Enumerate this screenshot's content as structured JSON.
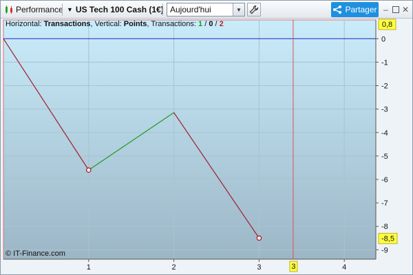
{
  "toolbar": {
    "app_title": "Performance",
    "instrument": "US Tech 100 Cash (1€)",
    "period_value": "Aujourd'hui",
    "share_label": "Partager",
    "icons": [
      "chart-candles-icon",
      "chevron-down-icon",
      "wrench-icon",
      "share-icon",
      "minimize-icon",
      "maximize-icon",
      "close-icon"
    ]
  },
  "info": {
    "horizontal_label": "Horizontal: ",
    "horizontal_value": "Transactions",
    "vertical_label": ", Vertical: ",
    "vertical_value": "Points",
    "transactions_label": ", Transactions: ",
    "wins": "1",
    "neutral": "0",
    "losses": "2",
    "sep": " / "
  },
  "watermark": "© IT-Finance.com",
  "colors": {
    "loss": "#a01c2a",
    "gain": "#1d9a1d",
    "zero_line": "#2020c0",
    "cursor": "#e05050",
    "highlight": "#ffff40"
  },
  "chart_data": {
    "type": "line",
    "points": [
      {
        "x": 0,
        "y": 0
      },
      {
        "x": 1,
        "y": -5.6
      },
      {
        "x": 2,
        "y": -3.15
      },
      {
        "x": 3,
        "y": -8.5
      }
    ],
    "segment_colors": [
      "loss",
      "gain",
      "loss"
    ],
    "markers_at": [
      1,
      3
    ],
    "x_ticks": [
      1,
      2,
      3,
      4
    ],
    "x_range": [
      0,
      4.37
    ],
    "y_ticks": [
      0,
      -1,
      -2,
      -3,
      -4,
      -5,
      -6,
      -7,
      -8,
      -9
    ],
    "y_range": [
      -9.4,
      0.8
    ],
    "cursor_x": 3.4,
    "top_label": "0,8",
    "right_highlight_label": "-8,5",
    "right_highlight_value": -8.5,
    "bottom_highlight_label": "3",
    "grid": true
  }
}
